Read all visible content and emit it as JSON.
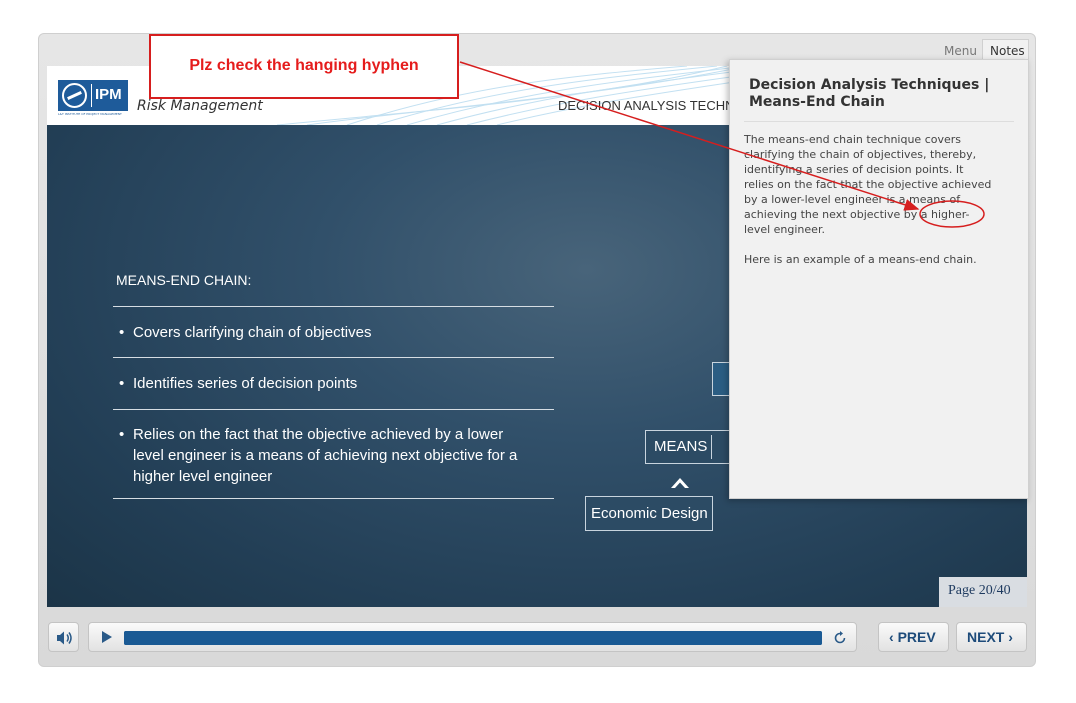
{
  "header": {
    "logo_text": "IPM",
    "logo_subtext": "L&T INSTITUTE OF PROJECT MANAGEMENT",
    "course_title": "Risk Management",
    "section_title": "DECISION ANALYSIS TECHN"
  },
  "slide": {
    "heading": "MEANS-END CHAIN:",
    "bullets": [
      "Covers clarifying chain of objectives",
      "Identifies series of decision points",
      "Relies on the fact that the objective achieved by a lower level engineer is a means of achieving next objective for a higher level engineer"
    ],
    "bullet_symbol": "•",
    "diagram": {
      "means_label": "MEANS",
      "economic_design_label": "Economic Design"
    },
    "page_indicator": "Page 20/40"
  },
  "tabs": {
    "menu": "Menu",
    "notes": "Notes",
    "active": "Notes"
  },
  "notes": {
    "title": "Decision Analysis Techniques | Means-End Chain",
    "paragraph_1": "The means-end chain technique covers clarifying the chain of objectives, thereby, identifying a series of decision points. It relies on the fact that the objective achieved by a lower-level engineer is a means of achieving the next objective by a higher-level engineer.",
    "paragraph_2": "Here is an example of a means-end chain."
  },
  "annotation": {
    "text": "Plz check the hanging hyphen",
    "color": "#e51c1c"
  },
  "controls": {
    "audio_icon": "speaker-icon",
    "play_icon": "play-icon",
    "replay_icon": "replay-icon",
    "progress": 1.0,
    "prev_label": "PREV",
    "next_label": "NEXT"
  },
  "colors": {
    "accent": "#1a5a94",
    "slide_bg": "#2c4a62"
  }
}
